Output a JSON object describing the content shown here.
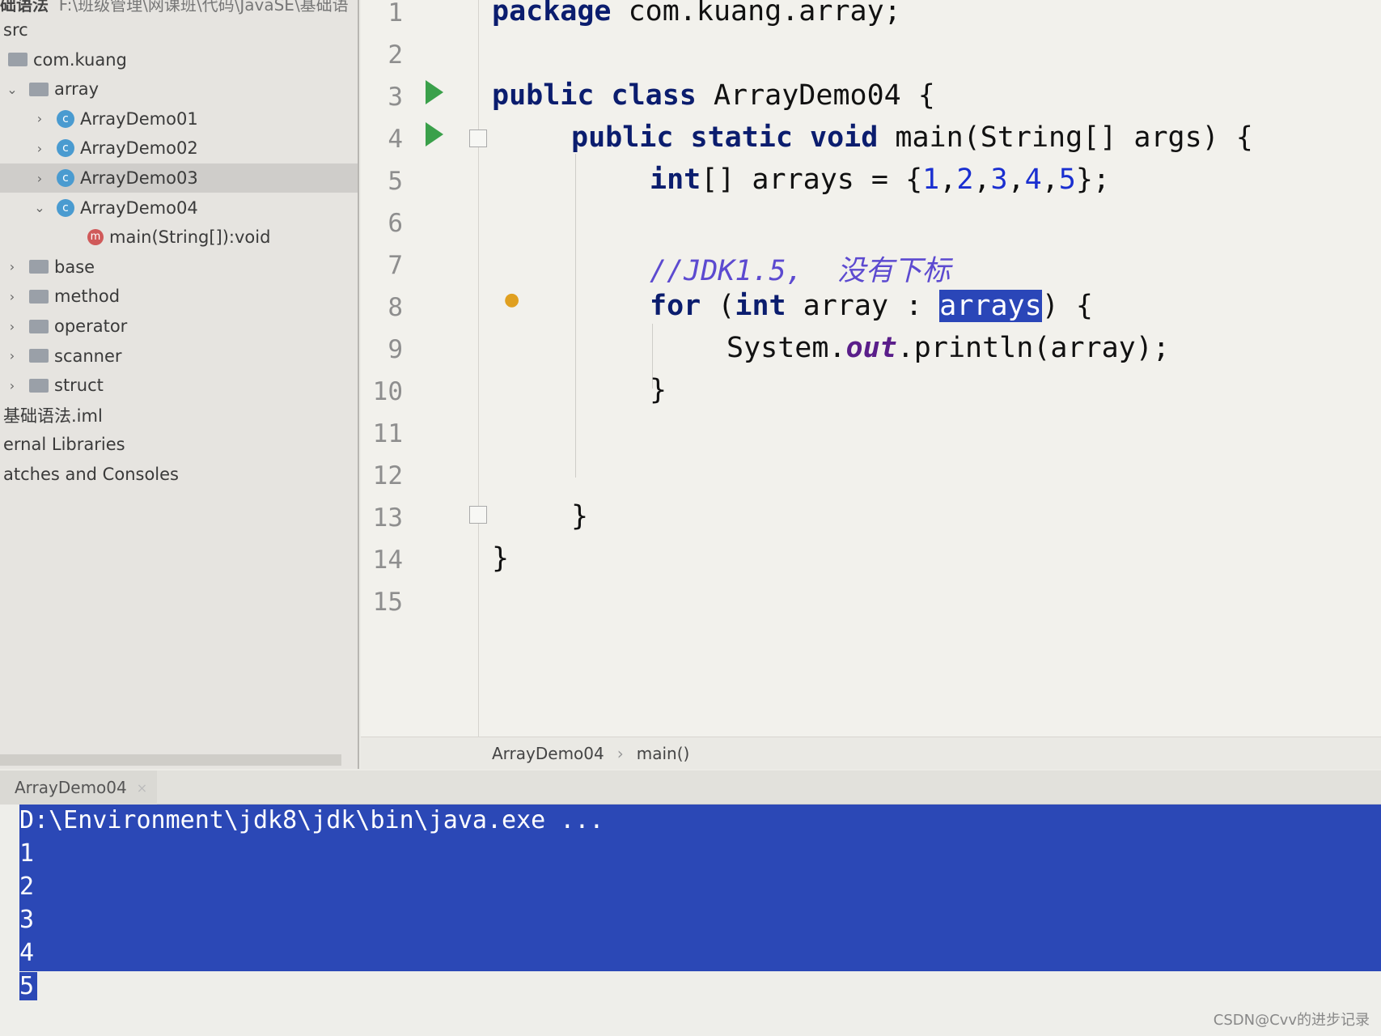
{
  "project_header": {
    "name": "础语法",
    "path": "F:\\班级管理\\网课班\\代码\\JavaSE\\基础语"
  },
  "tree": [
    {
      "label": "src",
      "type": "text",
      "indent": 0
    },
    {
      "label": "com.kuang",
      "type": "folder",
      "indent": 0
    },
    {
      "label": "array",
      "type": "folder",
      "expanded": true,
      "indent": 1
    },
    {
      "label": "ArrayDemo01",
      "type": "class",
      "indent": 2
    },
    {
      "label": "ArrayDemo02",
      "type": "class",
      "indent": 2
    },
    {
      "label": "ArrayDemo03",
      "type": "class",
      "indent": 2,
      "selected": true
    },
    {
      "label": "ArrayDemo04",
      "type": "class",
      "expanded": true,
      "indent": 2
    },
    {
      "label": "main(String[]):void",
      "type": "method",
      "indent": 3
    },
    {
      "label": "base",
      "type": "folder",
      "indent": 1
    },
    {
      "label": "method",
      "type": "folder",
      "indent": 1
    },
    {
      "label": "operator",
      "type": "folder",
      "indent": 1
    },
    {
      "label": "scanner",
      "type": "folder",
      "indent": 1
    },
    {
      "label": "struct",
      "type": "folder",
      "indent": 1
    },
    {
      "label": "基础语法.iml",
      "type": "text",
      "indent": 0
    },
    {
      "label": "ernal Libraries",
      "type": "text",
      "indent": 0
    },
    {
      "label": "atches and Consoles",
      "type": "text",
      "indent": 0
    }
  ],
  "editor": {
    "line_numbers": [
      "1",
      "2",
      "3",
      "4",
      "5",
      "6",
      "7",
      "8",
      "9",
      "10",
      "11",
      "12",
      "13",
      "14",
      "15"
    ],
    "code": {
      "l1a": "package",
      "l1b": " com.kuang.array;",
      "l3a": "public class",
      "l3b": " ArrayDemo04 {",
      "l4a": "public static void",
      "l4b": " main(String[] args) {",
      "l5a": "int",
      "l5b": "[] arrays = {",
      "n1": "1",
      "n2": "2",
      "n3": "3",
      "n4": "4",
      "n5": "5",
      "l5c": "};",
      "l7": "//JDK1.5,  没有下标",
      "l8a": "for",
      "l8b": " (",
      "l8c": "int",
      "l8d": " array : ",
      "l8e": "arrays",
      "l8f": ") {",
      "l9a": "System.",
      "l9b": "out",
      "l9c": ".println(array);",
      "l10": "}",
      "l13": "}",
      "l14": "}"
    },
    "sep": ","
  },
  "breadcrumb": {
    "items": [
      "ArrayDemo04",
      "main()"
    ],
    "separator": "›"
  },
  "run_tab": {
    "label": "ArrayDemo04",
    "close": "×"
  },
  "console": {
    "lines": [
      "D:\\Environment\\jdk8\\jdk\\bin\\java.exe ...",
      "1",
      "2",
      "3",
      "4",
      "5"
    ]
  },
  "watermark": "CSDN@Cvv的进步记录",
  "colors": {
    "keyword": "#0b1d6e",
    "number": "#1a2fd0",
    "comment": "#5c4ad0",
    "selection": "#2b48b6",
    "run": "#3aa04a"
  }
}
